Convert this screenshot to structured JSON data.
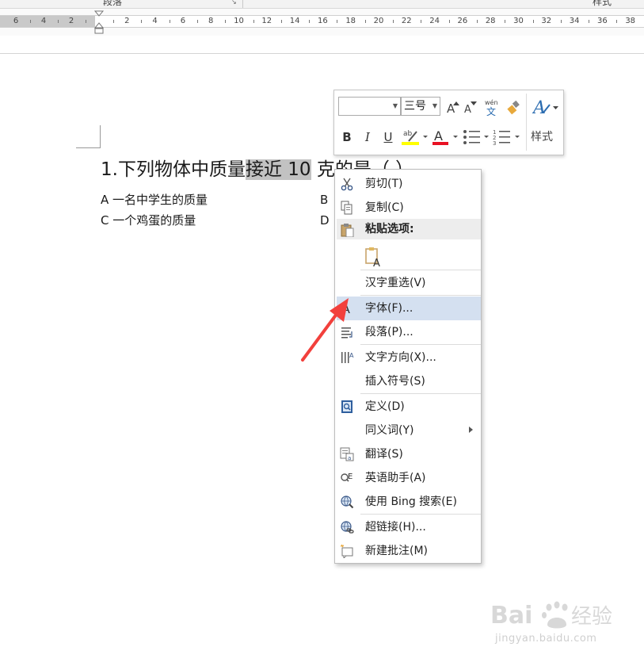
{
  "ribbon": {
    "group_paragraph": "段落",
    "group_styles": "样式"
  },
  "ruler": {
    "labels": [
      "6",
      "4",
      "2",
      "2",
      "4",
      "6",
      "8",
      "10",
      "12",
      "14",
      "16",
      "18",
      "20",
      "22",
      "24",
      "26",
      "28",
      "30",
      "32",
      "34",
      "36",
      "38"
    ]
  },
  "document": {
    "question": {
      "before": "1.下列物体中质量",
      "selected": "接近 10",
      "after": " 克的是（    ）"
    },
    "options": {
      "a": "A 一名中学生的质量",
      "b": "B",
      "c": "C 一个鸡蛋的质量",
      "d": "D"
    }
  },
  "mini_toolbar": {
    "font_name": "",
    "font_size": "三号",
    "bold": "B",
    "italic": "I",
    "underline": "U",
    "styles_label": "样式",
    "colors": {
      "highlight": "#ffff00",
      "font_color": "#e81123"
    }
  },
  "context_menu": {
    "items": [
      {
        "label": "剪切(T)",
        "icon": "scissors-icon"
      },
      {
        "label": "复制(C)",
        "icon": "copy-icon"
      },
      {
        "label": "粘贴选项:",
        "icon": "clipboard-icon"
      },
      {
        "label": "汉字重选(V)",
        "icon": ""
      },
      {
        "label": "字体(F)...",
        "icon": "font-icon"
      },
      {
        "label": "段落(P)...",
        "icon": "paragraph-icon"
      },
      {
        "label": "文字方向(X)...",
        "icon": "text-direction-icon"
      },
      {
        "label": "插入符号(S)",
        "icon": ""
      },
      {
        "label": "定义(D)",
        "icon": "define-icon"
      },
      {
        "label": "同义词(Y)",
        "icon": ""
      },
      {
        "label": "翻译(S)",
        "icon": "translate-icon"
      },
      {
        "label": "英语助手(A)",
        "icon": "english-assistant-icon"
      },
      {
        "label": "使用 Bing 搜索(E)",
        "icon": "bing-search-icon"
      },
      {
        "label": "超链接(H)...",
        "icon": "hyperlink-icon"
      },
      {
        "label": "新建批注(M)",
        "icon": "new-comment-icon"
      }
    ],
    "colors": {
      "hover": "#d4e0f0",
      "header": "#ededed"
    }
  },
  "annotation": {
    "arrow_color": "#f2403c"
  },
  "watermark": {
    "text": "jingyan.baidu.com"
  }
}
